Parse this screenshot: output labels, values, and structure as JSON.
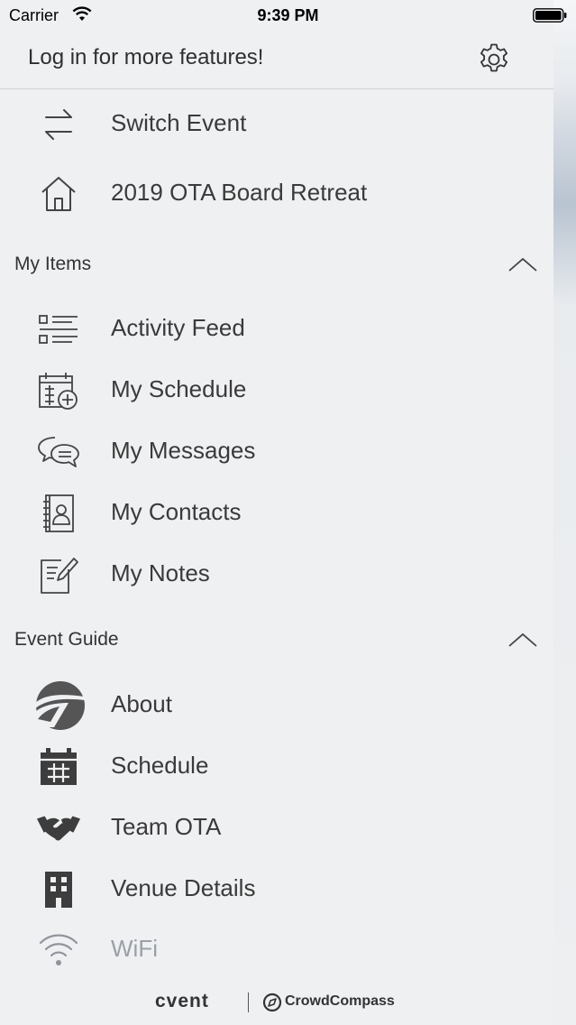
{
  "status_bar": {
    "carrier": "Carrier",
    "time": "9:39 PM"
  },
  "header": {
    "login_prompt": "Log in for more features!"
  },
  "top_items": [
    {
      "label": "Switch Event",
      "icon": "switch-arrows-icon"
    },
    {
      "label": "2019 OTA Board Retreat",
      "icon": "home-icon"
    }
  ],
  "my_items": {
    "title": "My Items",
    "items": [
      {
        "label": "Activity Feed",
        "icon": "list-icon"
      },
      {
        "label": "My Schedule",
        "icon": "calendar-add-icon"
      },
      {
        "label": "My Messages",
        "icon": "chat-bubbles-icon"
      },
      {
        "label": "My Contacts",
        "icon": "contacts-book-icon"
      },
      {
        "label": "My Notes",
        "icon": "note-edit-icon"
      }
    ]
  },
  "event_guide": {
    "title": "Event Guide",
    "items": [
      {
        "label": "About",
        "icon": "ota-logo-icon"
      },
      {
        "label": "Schedule",
        "icon": "calendar-icon"
      },
      {
        "label": "Team OTA",
        "icon": "handshake-icon"
      },
      {
        "label": "Venue Details",
        "icon": "building-icon"
      },
      {
        "label": "WiFi",
        "icon": "wifi-icon"
      }
    ]
  },
  "footer": {
    "brand": "cvent",
    "partner": "CrowdCompass"
  }
}
